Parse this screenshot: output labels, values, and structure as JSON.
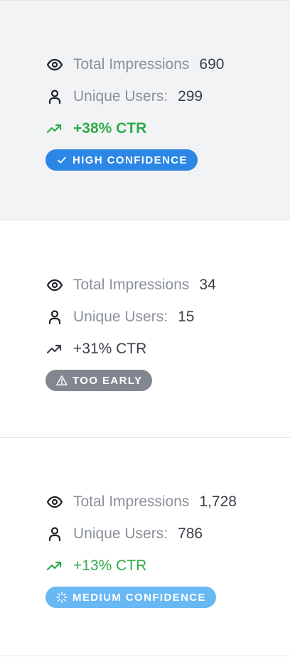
{
  "cards": [
    {
      "impressions_label": "Total Impressions",
      "impressions_value": "690",
      "users_label": "Unique Users:",
      "users_value": "299",
      "ctr": "+38% CTR",
      "badge": "HIGH CONFIDENCE",
      "badge_icon": "check-icon"
    },
    {
      "impressions_label": "Total Impressions",
      "impressions_value": "34",
      "users_label": "Unique Users:",
      "users_value": "15",
      "ctr": "+31% CTR",
      "badge": "TOO EARLY",
      "badge_icon": "warning-icon"
    },
    {
      "impressions_label": "Total Impressions",
      "impressions_value": "1,728",
      "users_label": "Unique Users:",
      "users_value": "786",
      "ctr": "+13% CTR",
      "badge": "MEDIUM CONFIDENCE",
      "badge_icon": "spinner-icon"
    }
  ],
  "colors": {
    "positive": "#2fab4c",
    "high_badge": "#2b86e6",
    "early_badge": "#80878f",
    "medium_badge": "#68b8f4",
    "muted_text": "#8a9099"
  }
}
